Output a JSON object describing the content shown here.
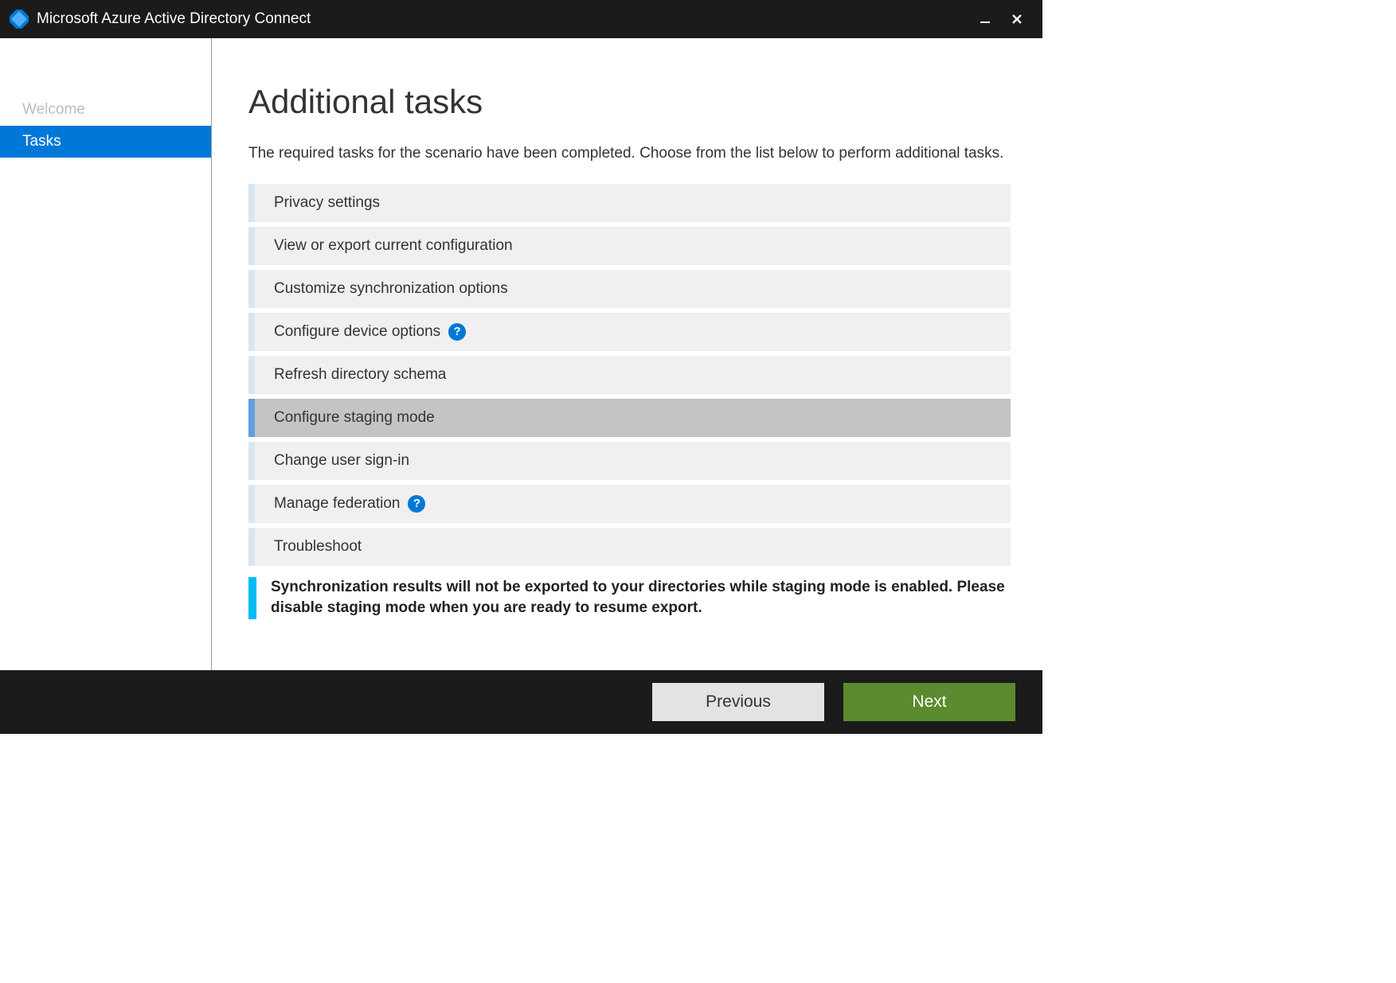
{
  "titlebar": {
    "title": "Microsoft Azure Active Directory Connect"
  },
  "sidebar": {
    "items": [
      {
        "label": "Welcome",
        "active": false
      },
      {
        "label": "Tasks",
        "active": true
      }
    ]
  },
  "main": {
    "heading": "Additional tasks",
    "subtitle": "The required tasks for the scenario have been completed. Choose from the list below to perform additional tasks.",
    "tasks": [
      {
        "label": "Privacy settings",
        "help": false,
        "selected": false
      },
      {
        "label": "View or export current configuration",
        "help": false,
        "selected": false
      },
      {
        "label": "Customize synchronization options",
        "help": false,
        "selected": false
      },
      {
        "label": "Configure device options",
        "help": true,
        "selected": false
      },
      {
        "label": "Refresh directory schema",
        "help": false,
        "selected": false
      },
      {
        "label": "Configure staging mode",
        "help": false,
        "selected": true
      },
      {
        "label": "Change user sign-in",
        "help": false,
        "selected": false
      },
      {
        "label": "Manage federation",
        "help": true,
        "selected": false
      },
      {
        "label": "Troubleshoot",
        "help": false,
        "selected": false
      }
    ],
    "notice": "Synchronization results will not be exported to your directories while staging mode is enabled. Please disable staging mode when you are ready to resume export."
  },
  "footer": {
    "previous": "Previous",
    "next": "Next"
  },
  "icons": {
    "help_glyph": "?"
  }
}
